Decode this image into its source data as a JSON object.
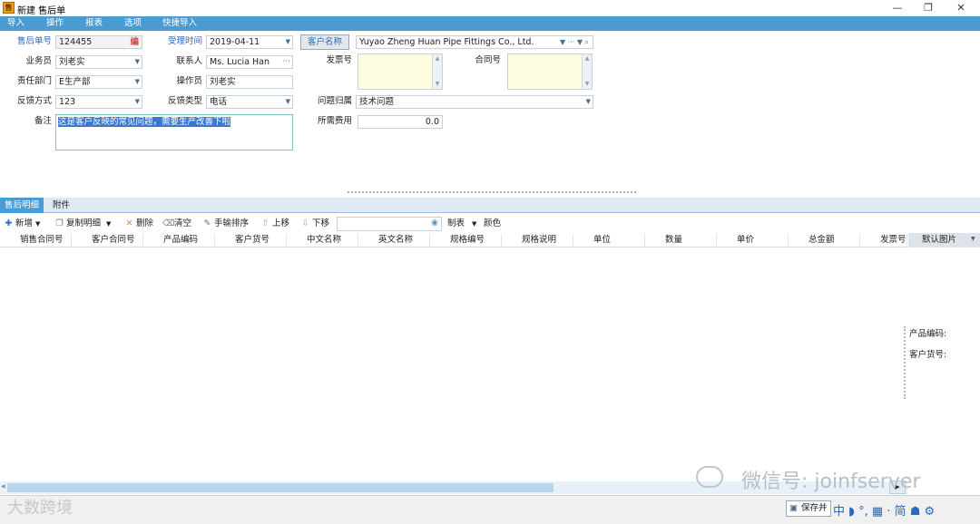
{
  "window": {
    "title": "新建 售后单",
    "app_icon": "app-logo",
    "controls": [
      "—",
      "❐",
      "✕"
    ]
  },
  "menu": [
    "导入",
    "操作",
    "报表",
    "选项",
    "快捷导入"
  ],
  "form": {
    "after_sale_no": {
      "label": "售后单号",
      "value": "124455",
      "tag": "编"
    },
    "accept_time": {
      "label": "受理时间",
      "value": "2019-04-11"
    },
    "customer_btn": "客户名称",
    "customer": {
      "value": "Yuyao Zheng Huan Pipe Fittings Co., Ltd."
    },
    "salesman": {
      "label": "业务员",
      "value": "刘老实"
    },
    "contact": {
      "label": "联系人",
      "value": "Ms. Lucia Han"
    },
    "invoice": {
      "label": "发票号"
    },
    "contract": {
      "label": "合同号"
    },
    "dept": {
      "label": "责任部门",
      "value": "E生产部"
    },
    "operator": {
      "label": "操作员",
      "value": "刘老实"
    },
    "feedback_way": {
      "label": "反馈方式",
      "value": "123"
    },
    "feedback_type": {
      "label": "反馈类型",
      "value": "电话"
    },
    "issue": {
      "label": "问题归属",
      "value": "技术问题"
    },
    "remark": {
      "label": "备注",
      "value": "这是客户反映的常见问题，需要生产改善下啦"
    },
    "cost": {
      "label": "所需费用",
      "value": "0.0"
    }
  },
  "tabs": [
    "售后明细",
    "附件"
  ],
  "toolbar": {
    "add": "新增",
    "copy": "复制明细",
    "delete": "删除",
    "clear": "清空",
    "sort": "手输排序",
    "up": "上移",
    "down": "下移",
    "table": "制表",
    "color": "颜色"
  },
  "grid": {
    "columns": [
      "销售合同号",
      "客户合同号",
      "产品编码",
      "客户货号",
      "中文名称",
      "英文名称",
      "规格编号",
      "规格说明",
      "单位",
      "数量",
      "单价",
      "总金额",
      "发票号"
    ],
    "image_header": "默认图片"
  },
  "side": {
    "product_code": "产品编码:",
    "cust_code": "客户货号:"
  },
  "status": {
    "save": "保存并",
    "ime": "中 ◗ °, ▦ · 简 ☗ ⚙"
  },
  "watermark": {
    "text": "微信号: joinfserver",
    "logo": "大数跨境"
  },
  "colors": {
    "accent": "#4a9bd4"
  }
}
